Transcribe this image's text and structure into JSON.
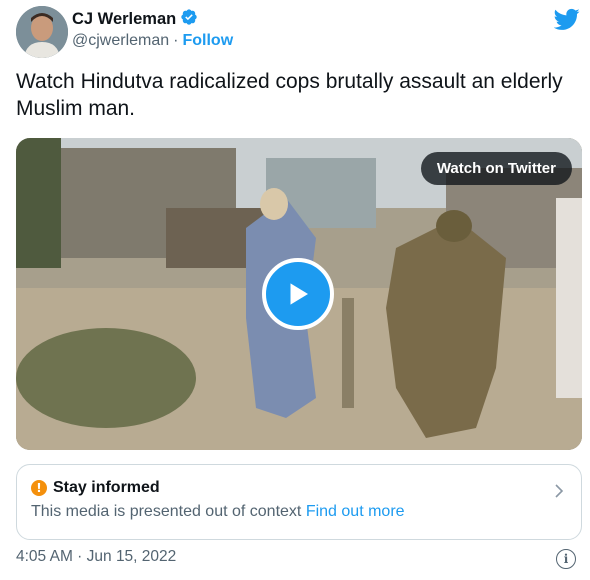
{
  "author": {
    "name": "CJ Werleman",
    "handle": "@cjwerleman",
    "separator": "·",
    "follow_label": "Follow",
    "verified": true
  },
  "tweet": {
    "text": "Watch Hindutva radicalized cops brutally assault an elderly Muslim man."
  },
  "media": {
    "watch_label": "Watch on Twitter"
  },
  "notice": {
    "title": "Stay informed",
    "body": "This media is presented out of context",
    "link_label": "Find out more"
  },
  "footer": {
    "timestamp": "4:05 AM · Jun 15, 2022"
  },
  "icons": {
    "brand": "twitter-bird-icon",
    "verified": "verified-badge-icon",
    "play": "play-icon",
    "warning": "warning-icon",
    "chevron": "chevron-right-icon",
    "info": "info-icon"
  },
  "colors": {
    "accent": "#1d9bf0",
    "text": "#0f1419",
    "muted": "#536471",
    "warning": "#f4900c"
  }
}
